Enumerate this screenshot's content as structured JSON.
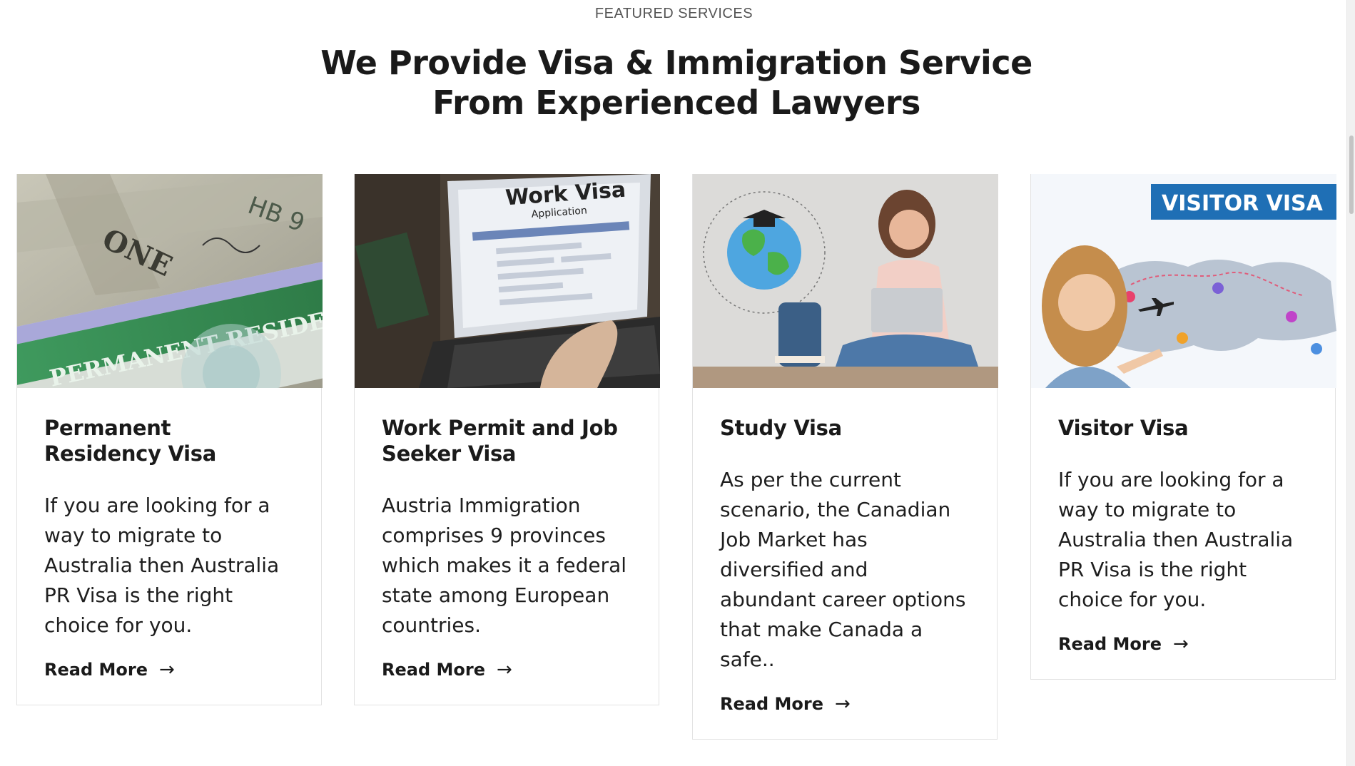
{
  "section": {
    "eyebrow": "FEATURED SERVICES",
    "headline_line1": "We Provide Visa & Immigration Service",
    "headline_line2": "From Experienced Lawyers"
  },
  "cards": [
    {
      "image": "permanent-resident-card-image",
      "image_text": "PERMANENT RESIDENT",
      "title": "Permanent Residency Visa",
      "description": "If you are looking for a way to migrate to Australia then Australia PR Visa is the right choice for you.",
      "link": "Read More"
    },
    {
      "image": "work-visa-laptop-image",
      "image_text_line1": "Work Visa",
      "image_text_line2": "Application",
      "title": "Work Permit and Job Seeker Visa",
      "description": "Austria Immigration comprises 9 provinces which makes it a federal state among European countries.",
      "link": "Read More"
    },
    {
      "image": "student-with-globe-image",
      "title": "Study Visa",
      "description": "As per the current scenario, the Canadian Job Market has diversified and abundant career options that make Canada a safe..",
      "link": "Read More"
    },
    {
      "image": "visitor-visa-map-image",
      "image_text": "VISITOR VISA",
      "title": "Visitor Visa",
      "description": "If you are looking for a way to migrate to Australia then Australia PR Visa is the right choice for you.",
      "link": "Read More"
    }
  ],
  "arrow_icon": "→",
  "colors": {
    "heading": "#1a1a1a",
    "card_border": "#e2e2e2",
    "visitor_badge": "#1f6fb5",
    "pr_card_green": "#2f8a4e"
  }
}
